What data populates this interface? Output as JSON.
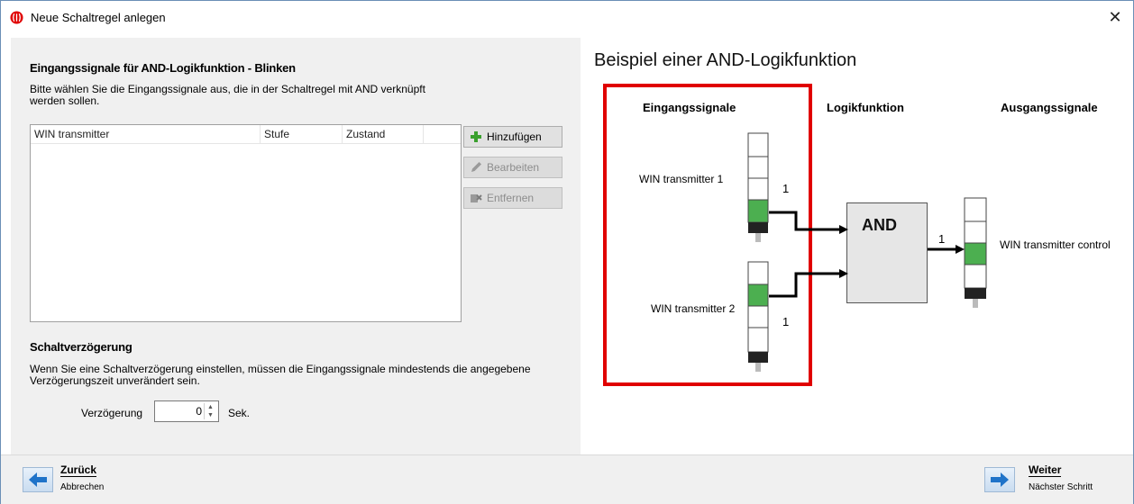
{
  "window": {
    "title": "Neue Schaltregel anlegen",
    "close_label": "✕"
  },
  "input_section": {
    "title": "Eingangssignale für AND-Logikfunktion - Blinken",
    "description_line1": "Bitte wählen Sie die Eingangssignale aus, die in der Schaltregel mit AND verknüpft",
    "description_line2": "werden sollen."
  },
  "table": {
    "columns": [
      "WIN transmitter",
      "Stufe",
      "Zustand",
      ""
    ],
    "rows": []
  },
  "buttons": {
    "add": "Hinzufügen",
    "edit": "Bearbeiten",
    "remove": "Entfernen"
  },
  "delay_section": {
    "title": "Schaltverzögerung",
    "description_line1": "Wenn Sie eine Schaltverzögerung einstellen, müssen die Eingangssignale mindestends die angegebene",
    "description_line2": "Verzögerungszeit unverändert sein.",
    "label": "Verzögerung",
    "value": "0",
    "unit": "Sek."
  },
  "footer": {
    "back_label": "Zurück",
    "back_sub": "Abbrechen",
    "next_label": "Weiter",
    "next_sub": "Nächster Schritt"
  },
  "diagram": {
    "title": "Beispiel einer AND-Logikfunktion",
    "col_inputs": "Eingangssignale",
    "col_logic": "Logikfunktion",
    "col_outputs": "Ausgangssignale",
    "input1_label": "WIN transmitter 1",
    "input1_value": "1",
    "input2_label": "WIN transmitter 2",
    "input2_value": "1",
    "logic_label": "AND",
    "output_value": "1",
    "output_label": "WIN transmitter control",
    "colors": {
      "green": "#4caf50",
      "highlight": "#e00000",
      "tower_base": "#222222"
    }
  },
  "icons": {
    "app": "app-logo-icon",
    "add": "plus-icon",
    "edit": "pencil-icon",
    "remove": "remove-icon",
    "back": "arrow-left-icon",
    "next": "arrow-right-icon"
  }
}
